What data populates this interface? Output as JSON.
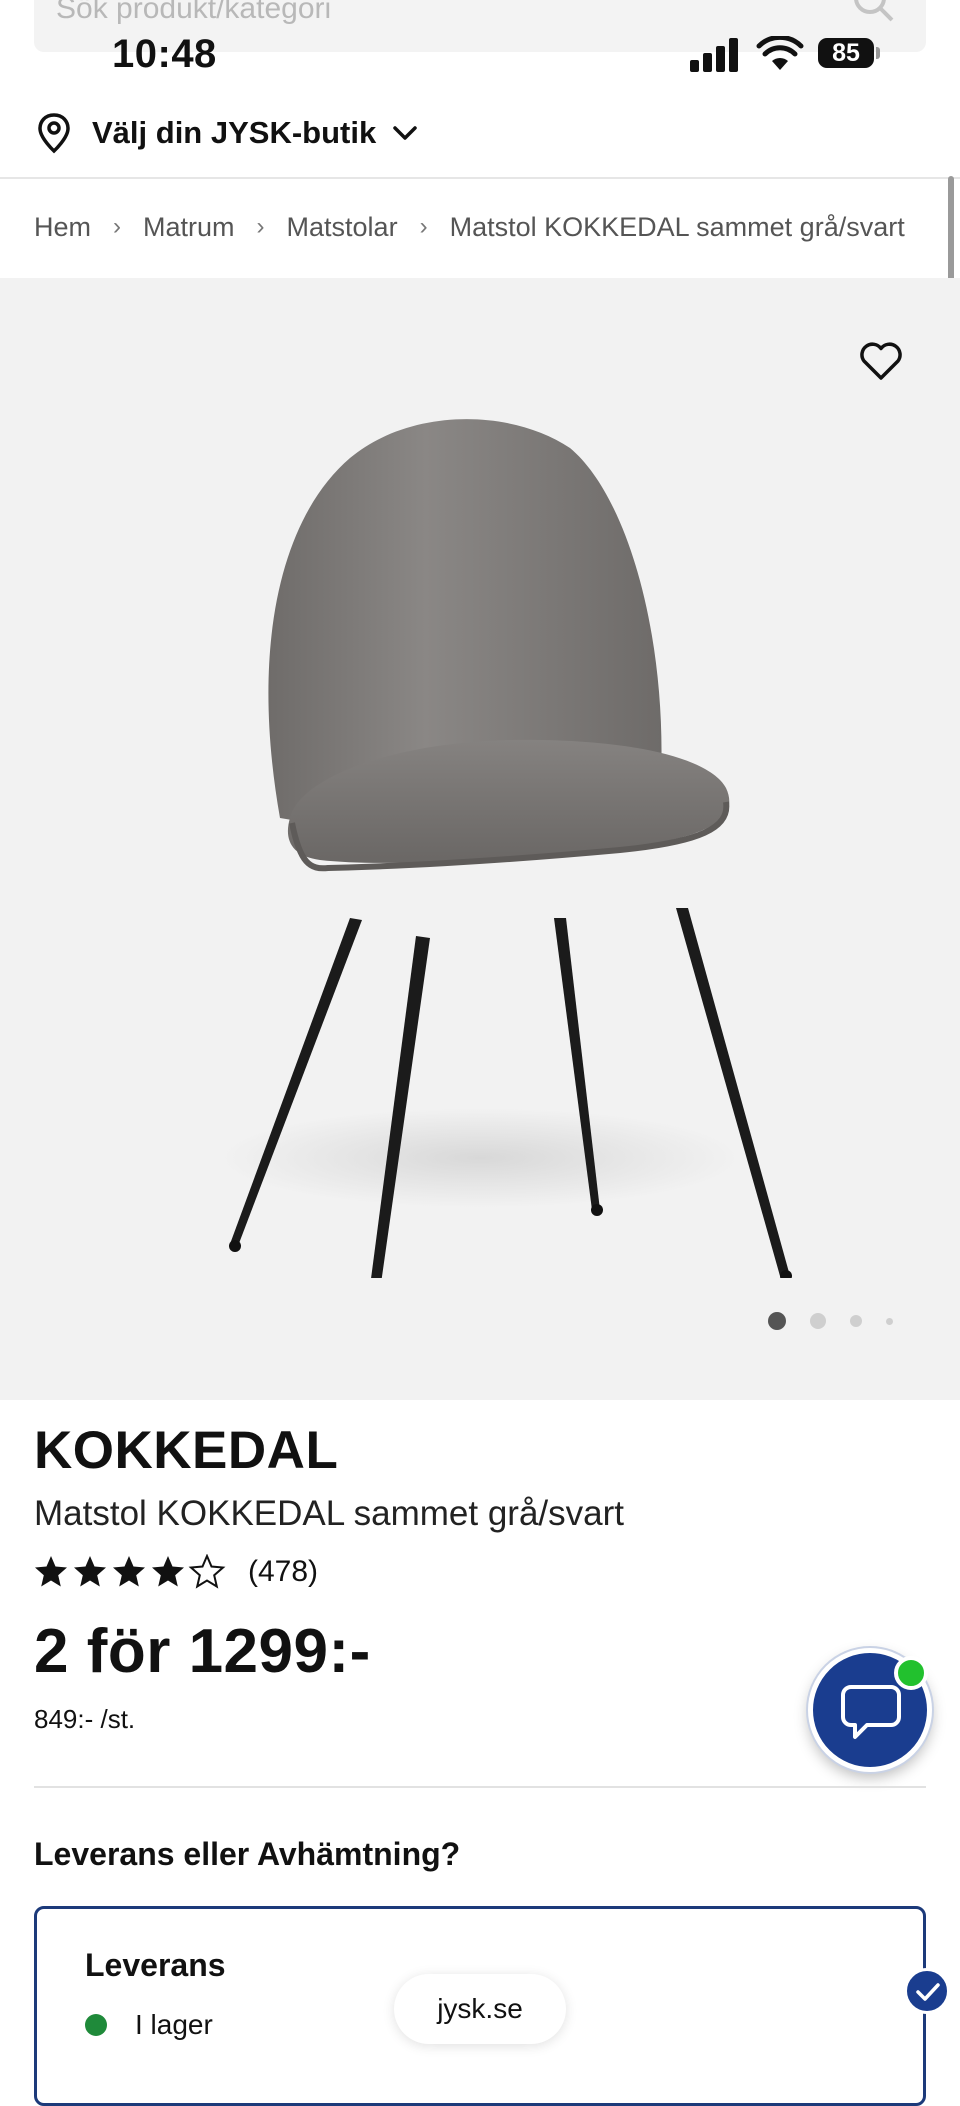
{
  "search": {
    "placeholder": "Sök produkt/kategori"
  },
  "status_bar": {
    "time": "10:48",
    "battery": "85"
  },
  "store_selector": {
    "label": "Välj din JYSK-butik"
  },
  "breadcrumb": [
    "Hem",
    "Matrum",
    "Matstolar",
    "Matstol KOKKEDAL sammet grå/svart"
  ],
  "gallery": {
    "image_count": 4,
    "active_index": 0
  },
  "product": {
    "brand": "KOKKEDAL",
    "name": "Matstol KOKKEDAL sammet grå/svart",
    "rating": 4.5,
    "review_count": "(478)",
    "price": "2 för 1299:-",
    "unit_price": "849:- /st."
  },
  "delivery": {
    "heading": "Leverans eller Avhämtning?",
    "option_title": "Leverans",
    "stock_status": "I lager"
  },
  "browser": {
    "url": "jysk.se"
  },
  "colors": {
    "brand_blue": "#1a3d8f",
    "card_border": "#1c3a7a",
    "in_stock_green": "#1f8a3a",
    "online_green": "#22c12e",
    "gallery_bg": "#f2f2f2"
  }
}
